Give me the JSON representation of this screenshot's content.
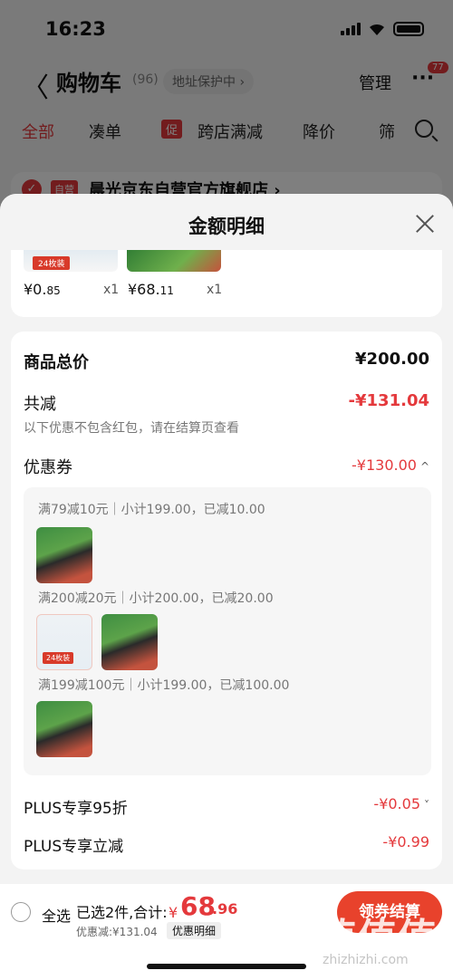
{
  "status_bar": {
    "time": "16:23"
  },
  "nav": {
    "back": "〈",
    "title": "购物车",
    "count": "(96)",
    "address_protect": "地址保护中 ›",
    "manage": "管理",
    "more": "···",
    "badge": "77"
  },
  "tabs": [
    {
      "label": "全部"
    },
    {
      "label": "凑单"
    },
    {
      "label": "跨店满减",
      "tag": "促"
    },
    {
      "label": "降价"
    },
    {
      "label": "筛"
    }
  ],
  "store": {
    "tag": "自营",
    "name": "晨光京东自营官方旗舰店 ›"
  },
  "sheet": {
    "title": "金额明细",
    "products": [
      {
        "price_int": "¥0.",
        "price_dec": "85",
        "qty": "x1",
        "label": "24枚装"
      },
      {
        "price_int": "¥68.",
        "price_dec": "11",
        "qty": "x1"
      }
    ],
    "total_price": {
      "label": "商品总价",
      "value": "¥200.00"
    },
    "total_reduce": {
      "label": "共减",
      "value": "-¥131.04",
      "note": "以下优惠不包含红包，请在结算页查看"
    },
    "coupon": {
      "label": "优惠券",
      "value": "-¥130.00",
      "chevron": "^"
    },
    "coupon_rules": [
      {
        "text": "满79减10元｜小计199.00，已减10.00"
      },
      {
        "text": "满200减20元｜小计200.00，已减20.00"
      },
      {
        "text": "满199减100元｜小计199.00，已减100.00"
      }
    ],
    "plus_95": {
      "label": "PLUS专享95折",
      "value": "-¥0.05",
      "chevron": "˅"
    },
    "plus_direct": {
      "label": "PLUS专享立减",
      "value": "-¥0.99"
    }
  },
  "bottom": {
    "select_all": "全选",
    "summary": "已选2件,合计:",
    "total_sym": "¥",
    "total_int": "68",
    "total_dec": ".96",
    "discount": "优惠减:¥131.04",
    "detail": "优惠明细",
    "checkout": "领券结算"
  },
  "watermark": {
    "logo": "值值值",
    "url": "zhizhizhi.com"
  },
  "colors": {
    "accent": "#e4393c",
    "checkout": "#e8422c"
  }
}
